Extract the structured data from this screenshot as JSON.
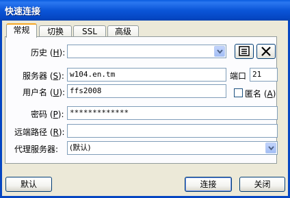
{
  "window": {
    "title": "快速连接"
  },
  "tabs": [
    {
      "label": "常规",
      "active": true
    },
    {
      "label": "切换",
      "active": false
    },
    {
      "label": "SSL",
      "active": false
    },
    {
      "label": "高级",
      "active": false
    }
  ],
  "form": {
    "history": {
      "label": "历史",
      "accel": "H",
      "value": ""
    },
    "server": {
      "label": "服务器",
      "accel": "S",
      "value": "w104.en.tm"
    },
    "port": {
      "label": "端口",
      "value": "21"
    },
    "username": {
      "label": "用户名",
      "accel": "U",
      "value": "ffs2008"
    },
    "anonymous": {
      "label": "匿名",
      "accel": "A",
      "checked": false
    },
    "password": {
      "label": "密码",
      "accel": "P",
      "value": "*************"
    },
    "remote_path": {
      "label": "远端路径",
      "accel": "R",
      "value": ""
    },
    "proxy": {
      "label": "代理服务器",
      "value": "(默认)"
    }
  },
  "buttons": {
    "default": "默认",
    "connect": "连接",
    "close": "关闭"
  },
  "icons": {
    "history_manage": "address-book-icon",
    "history_clear": "x-icon",
    "combo": "chevron-down-icon"
  },
  "colors": {
    "titlebar": "#0546c2",
    "face": "#ece9d8",
    "tab_highlight": "#f5a623"
  }
}
